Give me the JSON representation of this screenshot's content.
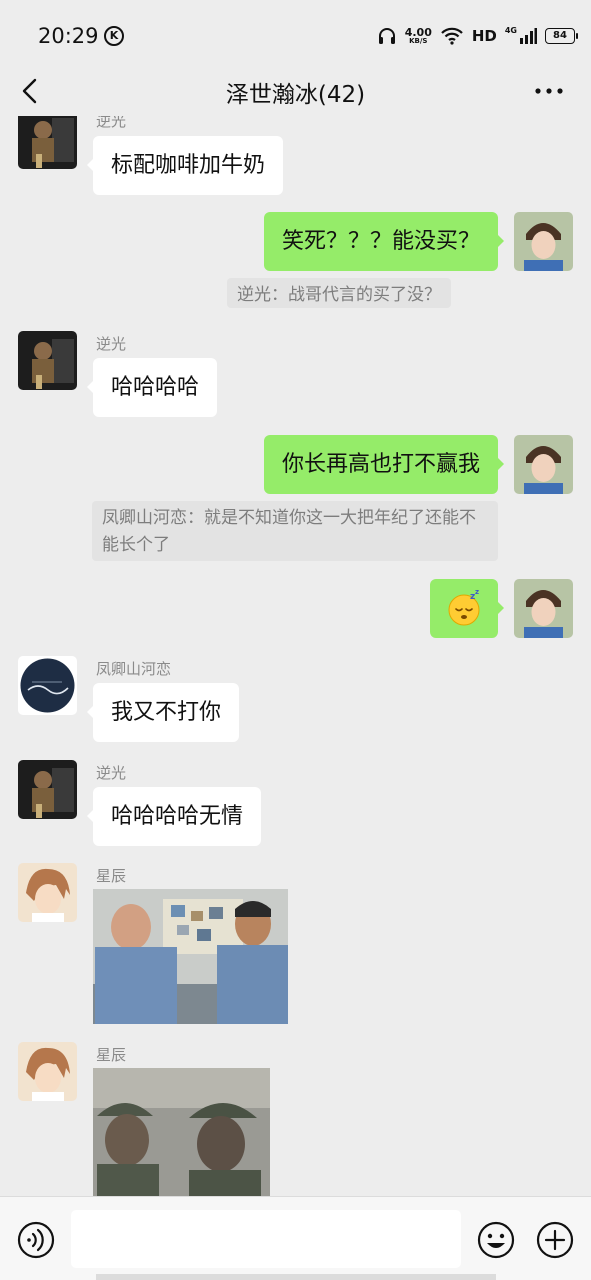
{
  "status_bar": {
    "time": "20:29",
    "k_badge": "K",
    "net_speed_value": "4.00",
    "net_speed_unit": "KB/S",
    "hd": "HD",
    "network": "4G",
    "battery": "84"
  },
  "header": {
    "title": "泽世瀚冰(42)"
  },
  "messages": [
    {
      "sender": "逆光",
      "text": "标配咖啡加牛奶"
    },
    {
      "text": "笑死？？？能没买？",
      "quote": "逆光：战哥代言的买了没？"
    },
    {
      "sender": "逆光",
      "text": "哈哈哈哈"
    },
    {
      "text": "你长再高也打不赢我",
      "quote": "凤卿山河恋：就是不知道你这一大把年纪了还能不能长个了"
    },
    {
      "emoji": "sleeping-face"
    },
    {
      "sender": "凤卿山河恋",
      "text": "我又不打你"
    },
    {
      "sender": "逆光",
      "text": "哈哈哈哈无情"
    },
    {
      "sender": "星辰",
      "image": "photo-two-police-officers"
    },
    {
      "sender": "星辰",
      "image": "photo-two-soldiers"
    }
  ],
  "input_bar": {
    "placeholder": "",
    "icons": [
      "voice-icon",
      "emoji-icon",
      "plus-icon"
    ]
  },
  "colors": {
    "background": "#ededed",
    "outgoing_bubble": "#95ec69",
    "incoming_bubble": "#ffffff",
    "quote_background": "#e3e3e3"
  }
}
